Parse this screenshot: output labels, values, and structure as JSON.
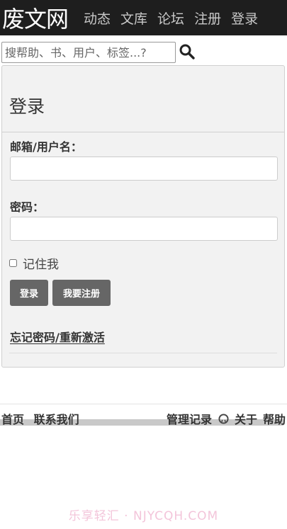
{
  "header": {
    "brand": "废文网",
    "nav": [
      "动态",
      "文库",
      "论坛",
      "注册",
      "登录"
    ]
  },
  "search": {
    "placeholder": "搜帮助、书、用户、标签...?",
    "value": "",
    "button_icon": "search-icon"
  },
  "login": {
    "title": "登录",
    "username_label": "邮箱/用户名：",
    "username_value": "",
    "password_label": "密码：",
    "password_value": "",
    "remember_label": "记住我",
    "remember_checked": false,
    "login_button": "登录",
    "register_button": "我要注册",
    "forgot_link": "忘记密码/重新激活"
  },
  "footer": {
    "left": [
      "首页",
      "联系我们"
    ],
    "manage": "管理记录",
    "github_icon": "github-icon",
    "right": [
      "关于",
      "帮助"
    ]
  },
  "watermark": "乐享轻汇 · NJYCQH.COM",
  "colors": {
    "topbar": "#1e1e1e",
    "button": "#666666",
    "panel": "#f2f2f2",
    "watermark": "#f3c5da"
  }
}
